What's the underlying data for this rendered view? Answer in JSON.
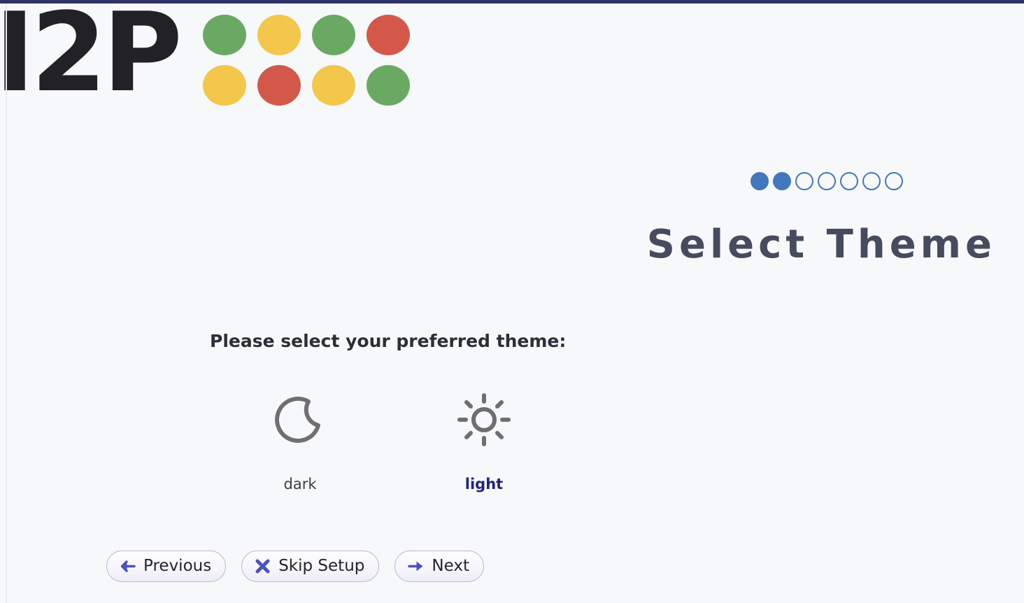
{
  "window": {
    "accent_bar_color": "#2e3468",
    "background_color": "#f7f8fa"
  },
  "logo": {
    "wordmark": "I2P",
    "wordmark_color": "#222226",
    "palette": {
      "green": "#6aa964",
      "yellow": "#f3c64c",
      "red": "#d4584a"
    },
    "dots": [
      {
        "row": 0,
        "col": 0,
        "color": "#6aa964",
        "name": "green"
      },
      {
        "row": 0,
        "col": 1,
        "color": "#f3c64c",
        "name": "yellow"
      },
      {
        "row": 0,
        "col": 2,
        "color": "#6aa964",
        "name": "green"
      },
      {
        "row": 0,
        "col": 3,
        "color": "#d4584a",
        "name": "red"
      },
      {
        "row": 1,
        "col": 0,
        "color": "#f3c64c",
        "name": "yellow"
      },
      {
        "row": 1,
        "col": 1,
        "color": "#d4584a",
        "name": "red"
      },
      {
        "row": 1,
        "col": 2,
        "color": "#f3c64c",
        "name": "yellow"
      },
      {
        "row": 1,
        "col": 3,
        "color": "#6aa964",
        "name": "green"
      }
    ]
  },
  "wizard": {
    "step_total": 7,
    "step_current": 2,
    "step_dot_color": "#4377bd",
    "steps": [
      {
        "index": 1,
        "completed": true
      },
      {
        "index": 2,
        "completed": true
      },
      {
        "index": 3,
        "completed": false
      },
      {
        "index": 4,
        "completed": false
      },
      {
        "index": 5,
        "completed": false
      },
      {
        "index": 6,
        "completed": false
      },
      {
        "index": 7,
        "completed": false
      }
    ],
    "title": "Select Theme",
    "title_color": "#464b5e"
  },
  "main": {
    "instruction": "Please select your preferred theme:",
    "selected_theme": "light",
    "themes": [
      {
        "id": "dark",
        "label": "dark",
        "icon": "moon-icon",
        "icon_color": "#6f6f72",
        "selected": false
      },
      {
        "id": "light",
        "label": "light",
        "icon": "sun-icon",
        "icon_color": "#6f6f72",
        "selected": true,
        "label_color": "#22257a"
      }
    ]
  },
  "nav": {
    "previous": {
      "label": "Previous",
      "icon": "arrow-left-icon",
      "icon_color": "#4b52c0"
    },
    "skip": {
      "label": "Skip Setup",
      "icon": "close-x-icon",
      "icon_color": "#4b52c0"
    },
    "next": {
      "label": "Next",
      "icon": "arrow-right-icon",
      "icon_color": "#4b52c0"
    }
  }
}
